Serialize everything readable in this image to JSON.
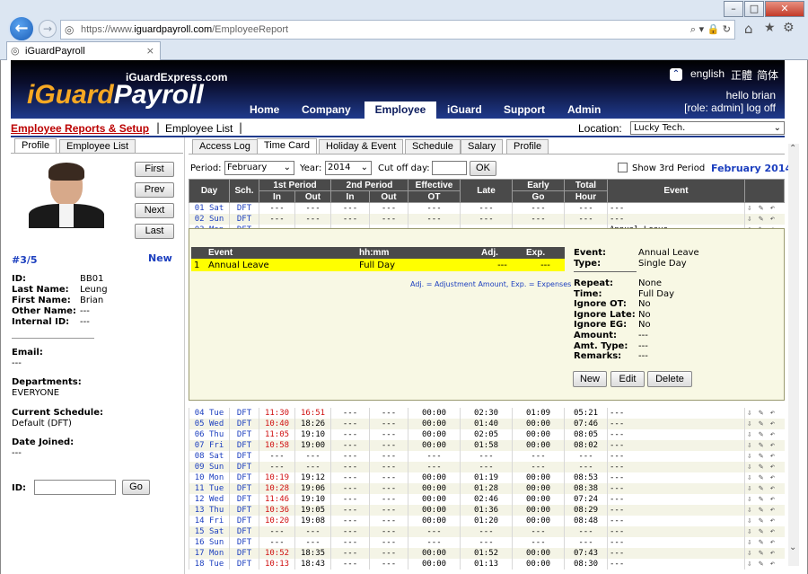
{
  "browser": {
    "url_prefix": "https://www.",
    "url_host": "iguardpayroll.com",
    "url_path": "/EmployeeReport",
    "tab_title": "iGuardPayroll"
  },
  "header": {
    "tagline": "iGuardExpress.com",
    "logo_a": "iGuard",
    "logo_b": "Payroll",
    "lang_en": "english",
    "lang_tc": "正體",
    "lang_sc": "简体",
    "hello": "hello brian",
    "role": "[role: admin] log off",
    "nav": [
      "Home",
      "Company",
      "Employee",
      "iGuard",
      "Support",
      "Admin"
    ]
  },
  "sub": {
    "reports": "Employee Reports & Setup",
    "separator": "|",
    "list": "Employee List",
    "location_label": "Location:",
    "location_value": "Lucky Tech."
  },
  "left_tabs": [
    "Profile",
    "Employee List"
  ],
  "right_tabs": [
    "Access Log",
    "Time Card",
    "Holiday & Event",
    "Schedule",
    "Salary",
    "Profile"
  ],
  "nav_buttons": [
    "First",
    "Prev",
    "Next",
    "Last"
  ],
  "profile": {
    "counter": "#3/5",
    "new": "New",
    "id_label": "ID:",
    "id": "BB01",
    "last_label": "Last Name:",
    "last": "Leung",
    "first_label": "First Name:",
    "first": "Brian",
    "other_label": "Other Name:",
    "other": "---",
    "internal_label": "Internal ID:",
    "internal": "---",
    "email_label": "Email:",
    "email": "---",
    "dept_label": "Departments:",
    "dept": "EVERYONE",
    "sched_label": "Current Schedule:",
    "sched": "Default (DFT)",
    "joined_label": "Date Joined:",
    "joined": "---",
    "search_label": "ID:",
    "go": "Go"
  },
  "filter": {
    "period_label": "Period:",
    "period": "February",
    "year_label": "Year:",
    "year": "2014",
    "cutoff_label": "Cut off day:",
    "ok": "OK",
    "show3rd": "Show 3rd Period",
    "month_title": "February 2014"
  },
  "columns": {
    "day": "Day",
    "sch": "Sch.",
    "p1": "1st Period",
    "p2": "2nd Period",
    "eff": "Effective",
    "eff2": "OT",
    "late": "Late",
    "early": "Early",
    "early2": "Go",
    "total": "Total",
    "total2": "Hour",
    "event": "Event",
    "in": "In",
    "out": "Out"
  },
  "rows_top": [
    [
      "01 Sat",
      "DFT",
      "---",
      "---",
      "---",
      "---",
      "---",
      "---",
      "---",
      "---",
      "---"
    ],
    [
      "02 Sun",
      "DFT",
      "---",
      "---",
      "---",
      "---",
      "---",
      "---",
      "---",
      "---",
      "---"
    ],
    [
      "03 Mon",
      "DFT",
      "---",
      "---",
      "---",
      "---",
      "---",
      "---",
      "---",
      "---",
      "Annual Leave"
    ]
  ],
  "event_panel": {
    "h_event": "Event",
    "h_hhmm": "hh:mm",
    "h_adj": "Adj.",
    "h_exp": "Exp.",
    "num": "1",
    "name": "Annual Leave",
    "hhmm": "Full Day",
    "adj": "---",
    "exp": "---",
    "note": "Adj. = Adjustment Amount, Exp. = Expenses",
    "details": [
      [
        "Event:",
        "Annual Leave"
      ],
      [
        "Type:",
        "Single Day"
      ],
      [
        "Repeat:",
        "None"
      ],
      [
        "Time:",
        "Full Day"
      ],
      [
        "Ignore OT:",
        "No"
      ],
      [
        "Ignore Late:",
        "No"
      ],
      [
        "Ignore EG:",
        "No"
      ],
      [
        "Amount:",
        "---"
      ],
      [
        "Amt. Type:",
        "---"
      ],
      [
        "Remarks:",
        "---"
      ]
    ],
    "new": "New",
    "edit": "Edit",
    "delete": "Delete"
  },
  "rows": [
    [
      "04 Tue",
      "DFT",
      "11:30",
      "16:51",
      "---",
      "---",
      "00:00",
      "02:30",
      "01:09",
      "05:21",
      "---"
    ],
    [
      "05 Wed",
      "DFT",
      "10:40",
      "18:26",
      "---",
      "---",
      "00:00",
      "01:40",
      "00:00",
      "07:46",
      "---"
    ],
    [
      "06 Thu",
      "DFT",
      "11:05",
      "19:10",
      "---",
      "---",
      "00:00",
      "02:05",
      "00:00",
      "08:05",
      "---"
    ],
    [
      "07 Fri",
      "DFT",
      "10:58",
      "19:00",
      "---",
      "---",
      "00:00",
      "01:58",
      "00:00",
      "08:02",
      "---"
    ],
    [
      "08 Sat",
      "DFT",
      "---",
      "---",
      "---",
      "---",
      "---",
      "---",
      "---",
      "---",
      "---"
    ],
    [
      "09 Sun",
      "DFT",
      "---",
      "---",
      "---",
      "---",
      "---",
      "---",
      "---",
      "---",
      "---"
    ],
    [
      "10 Mon",
      "DFT",
      "10:19",
      "19:12",
      "---",
      "---",
      "00:00",
      "01:19",
      "00:00",
      "08:53",
      "---"
    ],
    [
      "11 Tue",
      "DFT",
      "10:28",
      "19:06",
      "---",
      "---",
      "00:00",
      "01:28",
      "00:00",
      "08:38",
      "---"
    ],
    [
      "12 Wed",
      "DFT",
      "11:46",
      "19:10",
      "---",
      "---",
      "00:00",
      "02:46",
      "00:00",
      "07:24",
      "---"
    ],
    [
      "13 Thu",
      "DFT",
      "10:36",
      "19:05",
      "---",
      "---",
      "00:00",
      "01:36",
      "00:00",
      "08:29",
      "---"
    ],
    [
      "14 Fri",
      "DFT",
      "10:20",
      "19:08",
      "---",
      "---",
      "00:00",
      "01:20",
      "00:00",
      "08:48",
      "---"
    ],
    [
      "15 Sat",
      "DFT",
      "---",
      "---",
      "---",
      "---",
      "---",
      "---",
      "---",
      "---",
      "---"
    ],
    [
      "16 Sun",
      "DFT",
      "---",
      "---",
      "---",
      "---",
      "---",
      "---",
      "---",
      "---",
      "---"
    ],
    [
      "17 Mon",
      "DFT",
      "10:52",
      "18:35",
      "---",
      "---",
      "00:00",
      "01:52",
      "00:00",
      "07:43",
      "---"
    ],
    [
      "18 Tue",
      "DFT",
      "10:13",
      "18:43",
      "---",
      "---",
      "00:00",
      "01:13",
      "00:00",
      "08:30",
      "---"
    ]
  ],
  "colors": {
    "accent": "#1f3a8c",
    "red": "#d01010",
    "blue": "#1c3fbf",
    "highlight": "#ffff00"
  }
}
